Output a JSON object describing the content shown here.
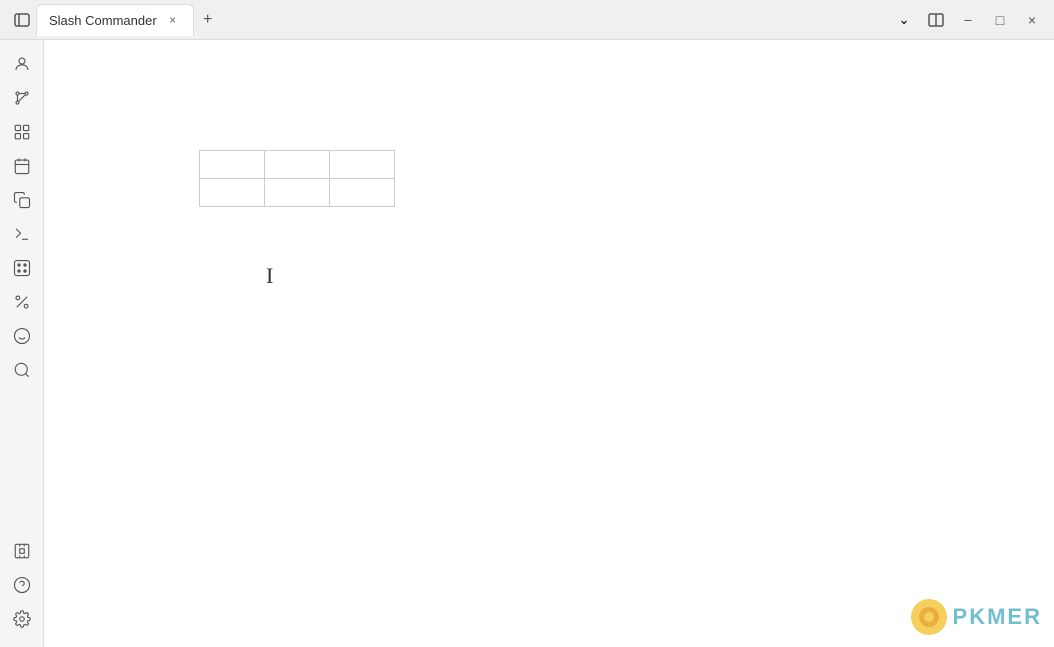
{
  "titleBar": {
    "tabTitle": "Slash Commander",
    "tabCloseLabel": "×",
    "newTabLabel": "+",
    "chevronLabel": "⌄",
    "splitViewLabel": "⧉",
    "minimizeLabel": "−",
    "maximizeLabel": "□",
    "closeLabel": "×"
  },
  "sidebar": {
    "topItems": [
      {
        "name": "user-icon",
        "label": "User"
      },
      {
        "name": "fork-icon",
        "label": "Fork"
      },
      {
        "name": "grid-icon",
        "label": "Grid"
      },
      {
        "name": "calendar-icon",
        "label": "Calendar"
      },
      {
        "name": "copy-icon",
        "label": "Copy"
      },
      {
        "name": "terminal-icon",
        "label": "Terminal"
      },
      {
        "name": "dice-icon",
        "label": "Dice"
      },
      {
        "name": "percent-icon",
        "label": "Percent"
      },
      {
        "name": "emoji-icon",
        "label": "Emoji"
      },
      {
        "name": "search-icon",
        "label": "Search"
      }
    ],
    "bottomItems": [
      {
        "name": "plugin-icon",
        "label": "Plugin"
      },
      {
        "name": "help-icon",
        "label": "Help"
      },
      {
        "name": "settings-icon",
        "label": "Settings"
      }
    ]
  },
  "content": {
    "table": {
      "rows": 2,
      "cols": 3
    }
  },
  "pkmer": {
    "text": "PKMER"
  }
}
